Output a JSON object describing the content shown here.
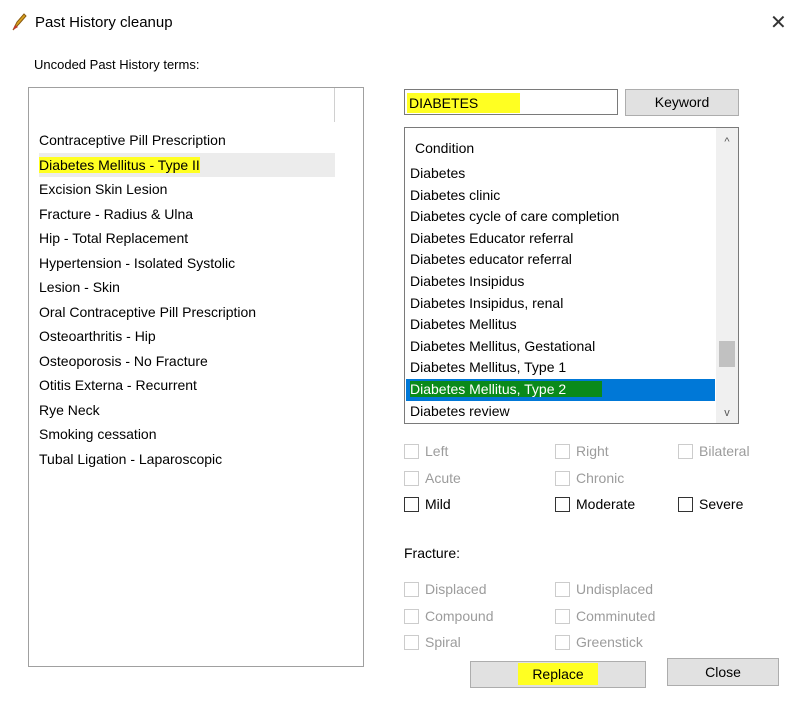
{
  "window": {
    "title": "Past History cleanup",
    "close_glyph": "✕",
    "icon": "pen-nib-icon"
  },
  "left": {
    "label": "Uncoded Past History terms:",
    "items": [
      {
        "label": "Contraceptive Pill Prescription"
      },
      {
        "label": "Diabetes Mellitus - Type II",
        "selected": true,
        "highlight": "#ffff22"
      },
      {
        "label": "Excision Skin Lesion"
      },
      {
        "label": "Fracture - Radius & Ulna"
      },
      {
        "label": "Hip - Total Replacement"
      },
      {
        "label": "Hypertension - Isolated Systolic"
      },
      {
        "label": "Lesion - Skin"
      },
      {
        "label": "Oral Contraceptive Pill Prescription"
      },
      {
        "label": "Osteoarthritis - Hip"
      },
      {
        "label": "Osteoporosis - No Fracture"
      },
      {
        "label": "Otitis Externa - Recurrent"
      },
      {
        "label": "Rye Neck"
      },
      {
        "label": "Smoking cessation"
      },
      {
        "label": "Tubal Ligation - Laparoscopic"
      }
    ]
  },
  "search": {
    "value": "DIABETES",
    "keyword_button": "Keyword"
  },
  "conditions": {
    "header": "Condition",
    "items": [
      {
        "label": "Diabetes"
      },
      {
        "label": "Diabetes clinic"
      },
      {
        "label": "Diabetes cycle of care completion"
      },
      {
        "label": "Diabetes Educator referral"
      },
      {
        "label": "Diabetes educator referral"
      },
      {
        "label": "Diabetes Insipidus"
      },
      {
        "label": "Diabetes Insipidus, renal"
      },
      {
        "label": "Diabetes Mellitus"
      },
      {
        "label": "Diabetes Mellitus, Gestational"
      },
      {
        "label": "Diabetes Mellitus, Type 1"
      },
      {
        "label": "Diabetes Mellitus, Type 2",
        "selected": true
      },
      {
        "label": "Diabetes review"
      }
    ],
    "scroll_up": "^",
    "scroll_down": "v"
  },
  "modifiers": {
    "left": "Left",
    "right": "Right",
    "bilateral": "Bilateral",
    "acute": "Acute",
    "chronic": "Chronic",
    "mild": "Mild",
    "moderate": "Moderate",
    "severe": "Severe"
  },
  "fracture": {
    "label": "Fracture:",
    "displaced": "Displaced",
    "undisplaced": "Undisplaced",
    "compound": "Compound",
    "comminuted": "Comminuted",
    "spiral": "Spiral",
    "greenstick": "Greenstick"
  },
  "buttons": {
    "replace": "Replace",
    "close": "Close"
  },
  "colors": {
    "highlight_yellow": "#ffff22",
    "selection_blue": "#0078d7",
    "selection_green": "#0a8a1a"
  }
}
